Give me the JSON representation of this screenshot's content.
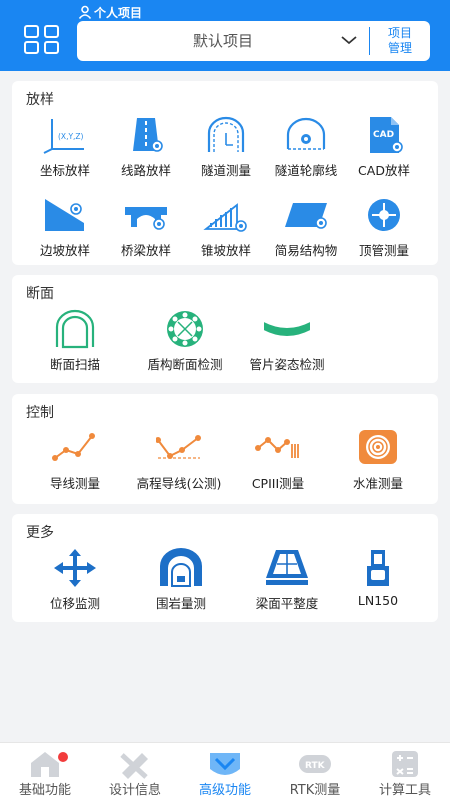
{
  "header": {
    "project_label": "个人项目",
    "selected_project": "默认项目",
    "manage_label_line1": "项目",
    "manage_label_line2": "管理"
  },
  "sections": {
    "stakeout": {
      "title": "放样",
      "items": [
        "坐标放样",
        "线路放样",
        "隧道测量",
        "隧道轮廓线",
        "CAD放样",
        "边坡放样",
        "桥梁放样",
        "锥坡放样",
        "简易结构物",
        "顶管测量"
      ],
      "coord_icon_text": "(X,Y,Z)",
      "cad_icon_text": "CAD"
    },
    "section": {
      "title": "断面",
      "items": [
        "断面扫描",
        "盾构断面检测",
        "管片姿态检测"
      ]
    },
    "control": {
      "title": "控制",
      "items": [
        "导线测量",
        "高程导线(公测)",
        "CPIII测量",
        "水准测量"
      ]
    },
    "more": {
      "title": "更多",
      "items": [
        "位移监测",
        "围岩量测",
        "梁面平整度",
        "LN150"
      ]
    }
  },
  "tabs": [
    {
      "label": "基础功能",
      "icon": "house-icon",
      "active": false
    },
    {
      "label": "设计信息",
      "icon": "ruler-pencil-icon",
      "active": false
    },
    {
      "label": "高级功能",
      "icon": "chevron-badge-icon",
      "active": true
    },
    {
      "label": "RTK测量",
      "icon": "rtk-icon",
      "active": false,
      "icon_text": "RTK"
    },
    {
      "label": "计算工具",
      "icon": "calculator-icon",
      "active": false
    }
  ],
  "colors": {
    "primary": "#1a86f2",
    "icon_blue": "#2a8be6",
    "icon_green": "#27b27c",
    "icon_orange": "#f08a3c",
    "badge_red": "#f23c3c",
    "inactive_icon": "#d0d3d8"
  }
}
